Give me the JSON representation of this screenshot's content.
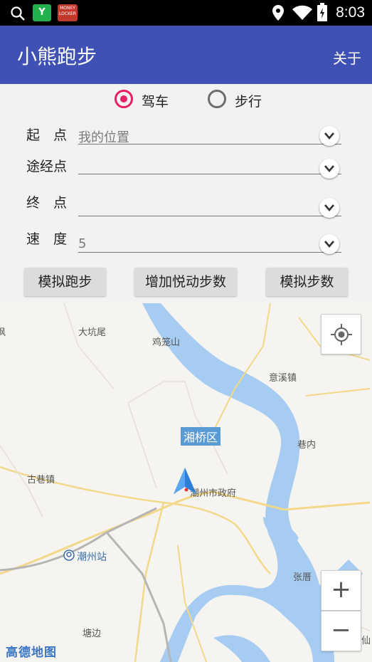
{
  "status_bar": {
    "time": "8:03",
    "app1_letter": "Y",
    "app2_text": "MONEY LOCKER"
  },
  "app_bar": {
    "title": "小熊跑步",
    "about": "关于"
  },
  "mode": {
    "options": [
      "驾车",
      "步行"
    ],
    "selected": "驾车"
  },
  "fields": {
    "start": {
      "label": "起　点",
      "value": "我的位置"
    },
    "via": {
      "label": "途经点",
      "value": ""
    },
    "end": {
      "label": "终　点",
      "value": ""
    },
    "speed": {
      "label": "速　度",
      "value": "5"
    }
  },
  "buttons": {
    "simulate_run": "模拟跑步",
    "add_steps": "增加悦动步数",
    "simulate_steps": "模拟步数"
  },
  "map": {
    "labels": {
      "dakengwei": "大坑尾",
      "jilongshan": "鸡笼山",
      "yixizhen": "意溪镇",
      "xiangqiao": "湘桥区",
      "xiangnei": "巷内",
      "guxiangzhen": "古巷镇",
      "gov": "潮州市政府",
      "station": "潮州站",
      "zhangcuo": "张厝",
      "tangbian": "塘边",
      "edge_left": "枫",
      "edge_right": "仙"
    },
    "zoom_in": "+",
    "zoom_out": "−",
    "logo": "高德地图",
    "colors": {
      "water": "#a6ccf2",
      "road": "#f7e3a6",
      "accent": "#e91e63",
      "appbar": "#3f51b5"
    }
  }
}
